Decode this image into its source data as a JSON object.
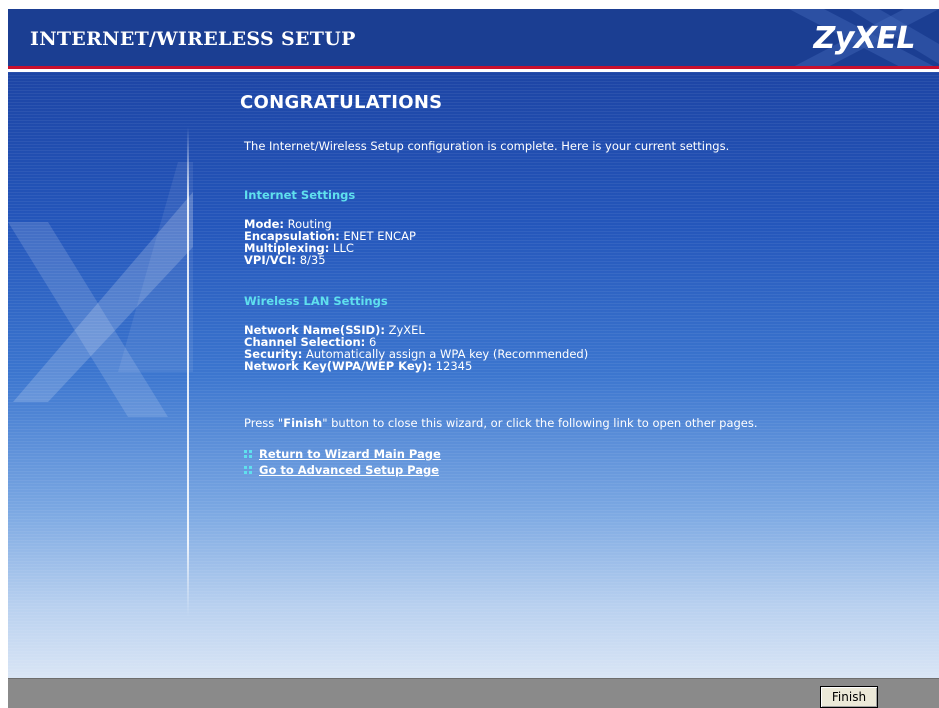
{
  "header": {
    "title": "INTERNET/WIRELESS SETUP",
    "logo": "ZyXEL"
  },
  "main": {
    "title": "CONGRATULATIONS",
    "intro": "The Internet/Wireless Setup configuration is complete. Here is your current settings.",
    "internet": {
      "heading": "Internet Settings",
      "items": [
        {
          "label": "Mode:",
          "value": "Routing"
        },
        {
          "label": "Encapsulation:",
          "value": "ENET ENCAP"
        },
        {
          "label": "Multiplexing:",
          "value": "LLC"
        },
        {
          "label": "VPI/VCI:",
          "value": "8/35"
        }
      ]
    },
    "wireless": {
      "heading": "Wireless LAN Settings",
      "items": [
        {
          "label": "Network Name(SSID):",
          "value": "ZyXEL"
        },
        {
          "label": "Channel Selection:",
          "value": "6"
        },
        {
          "label": "Security:",
          "value": "Automatically assign a WPA key (Recommended)"
        },
        {
          "label": "Network Key(WPA/WEP Key):",
          "value": "12345"
        }
      ]
    },
    "press": {
      "before": "Press \"",
      "bold": "Finish",
      "after": "\" button to close this wizard, or click the following link to open other pages."
    },
    "links": [
      {
        "label": "Return to Wizard Main Page"
      },
      {
        "label": "Go to Advanced Setup Page"
      }
    ]
  },
  "footer": {
    "finish_label": "Finish"
  },
  "colors": {
    "header_bg": "#1b3e92",
    "accent_red": "#c8102e",
    "heading_cyan": "#5fe0ee",
    "footer_bg": "#8a8a8a"
  }
}
